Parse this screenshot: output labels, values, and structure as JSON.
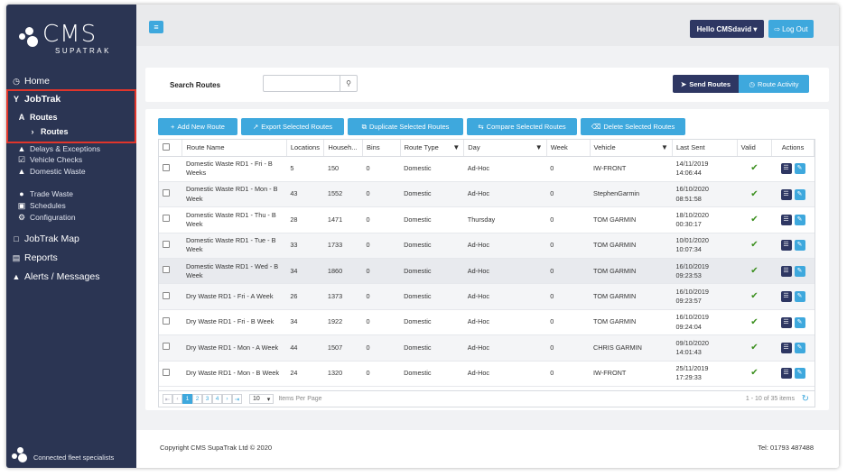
{
  "brand": {
    "logo_text": "CMS",
    "logo_sub": "SUPATRAK",
    "tagline": "Connected fleet specialists"
  },
  "sidebar": {
    "home": "Home",
    "jobtrak": "JobTrak",
    "routes_group": "Routes",
    "routes_item": "Routes",
    "delays": "Delays & Exceptions",
    "vehicle_checks": "Vehicle Checks",
    "domestic_waste": "Domestic Waste",
    "trade_waste": "Trade Waste",
    "schedules": "Schedules",
    "configuration": "Configuration",
    "jobtrak_map": "JobTrak Map",
    "reports": "Reports",
    "alerts": "Alerts / Messages"
  },
  "header": {
    "hello": "Hello CMSdavid",
    "logout": "Log Out"
  },
  "search": {
    "label": "Search Routes",
    "placeholder": "",
    "send_routes": "Send Routes",
    "route_activity": "Route Activity"
  },
  "toolbar": {
    "add": "Add New Route",
    "export": "Export Selected Routes",
    "duplicate": "Duplicate Selected Routes",
    "compare": "Compare Selected Routes",
    "delete": "Delete Selected Routes"
  },
  "columns": [
    "Route Name",
    "Locations",
    "Househ...",
    "Bins",
    "Route Type",
    "Day",
    "Week",
    "Vehicle",
    "Last Sent",
    "Valid",
    "Actions"
  ],
  "rows": [
    {
      "name": "Domestic Waste RD1 - Fri - B Weeks",
      "locations": "5",
      "households": "150",
      "bins": "0",
      "type": "Domestic",
      "day": "Ad-Hoc",
      "week": "0",
      "vehicle": "IW-FRONT",
      "sent_date": "14/11/2019",
      "sent_time": "14:06:44"
    },
    {
      "name": "Domestic Waste RD1 - Mon - B Week",
      "locations": "43",
      "households": "1552",
      "bins": "0",
      "type": "Domestic",
      "day": "Ad-Hoc",
      "week": "0",
      "vehicle": "StephenGarmin",
      "sent_date": "16/10/2020",
      "sent_time": "08:51:58"
    },
    {
      "name": "Domestic Waste RD1 - Thu - B Week",
      "locations": "28",
      "households": "1471",
      "bins": "0",
      "type": "Domestic",
      "day": "Thursday",
      "week": "0",
      "vehicle": "TOM GARMIN",
      "sent_date": "18/10/2020",
      "sent_time": "00:30:17"
    },
    {
      "name": "Domestic Waste RD1 - Tue - B Week",
      "locations": "33",
      "households": "1733",
      "bins": "0",
      "type": "Domestic",
      "day": "Ad-Hoc",
      "week": "0",
      "vehicle": "TOM GARMIN",
      "sent_date": "10/01/2020",
      "sent_time": "10:07:34"
    },
    {
      "name": "Domestic Waste RD1 - Wed - B Week",
      "locations": "34",
      "households": "1860",
      "bins": "0",
      "type": "Domestic",
      "day": "Ad-Hoc",
      "week": "0",
      "vehicle": "TOM GARMIN",
      "sent_date": "16/10/2019",
      "sent_time": "09:23:53"
    },
    {
      "name": "Dry Waste RD1 - Fri - A Week",
      "locations": "26",
      "households": "1373",
      "bins": "0",
      "type": "Domestic",
      "day": "Ad-Hoc",
      "week": "0",
      "vehicle": "TOM GARMIN",
      "sent_date": "16/10/2019",
      "sent_time": "09:23:57"
    },
    {
      "name": "Dry Waste RD1 - Fri - B Week",
      "locations": "34",
      "households": "1922",
      "bins": "0",
      "type": "Domestic",
      "day": "Ad-Hoc",
      "week": "0",
      "vehicle": "TOM GARMIN",
      "sent_date": "16/10/2019",
      "sent_time": "09:24:04"
    },
    {
      "name": "Dry Waste RD1 - Mon - A Week",
      "locations": "44",
      "households": "1507",
      "bins": "0",
      "type": "Domestic",
      "day": "Ad-Hoc",
      "week": "0",
      "vehicle": "CHRIS GARMIN",
      "sent_date": "09/10/2020",
      "sent_time": "14:01:43"
    },
    {
      "name": "Dry Waste RD1 - Mon - B Week",
      "locations": "24",
      "households": "1320",
      "bins": "0",
      "type": "Domestic",
      "day": "Ad-Hoc",
      "week": "0",
      "vehicle": "IW-FRONT",
      "sent_date": "25/11/2019",
      "sent_time": "17:29:33"
    }
  ],
  "pager": {
    "pages": [
      "1",
      "2",
      "3",
      "4"
    ],
    "active_page": "1",
    "per_page": "10",
    "per_page_label": "Items Per Page",
    "info": "1 - 10 of 35 items"
  },
  "footer": {
    "copyright": "Copyright CMS SupaTrak Ltd © 2020",
    "tel": "Tel: 01793 487488"
  },
  "colors": {
    "sidebar": "#2b3553",
    "primary": "#3ea8dd",
    "dark_button": "#2e3763",
    "valid": "#3b8f1e",
    "highlight": "#e0352b"
  }
}
